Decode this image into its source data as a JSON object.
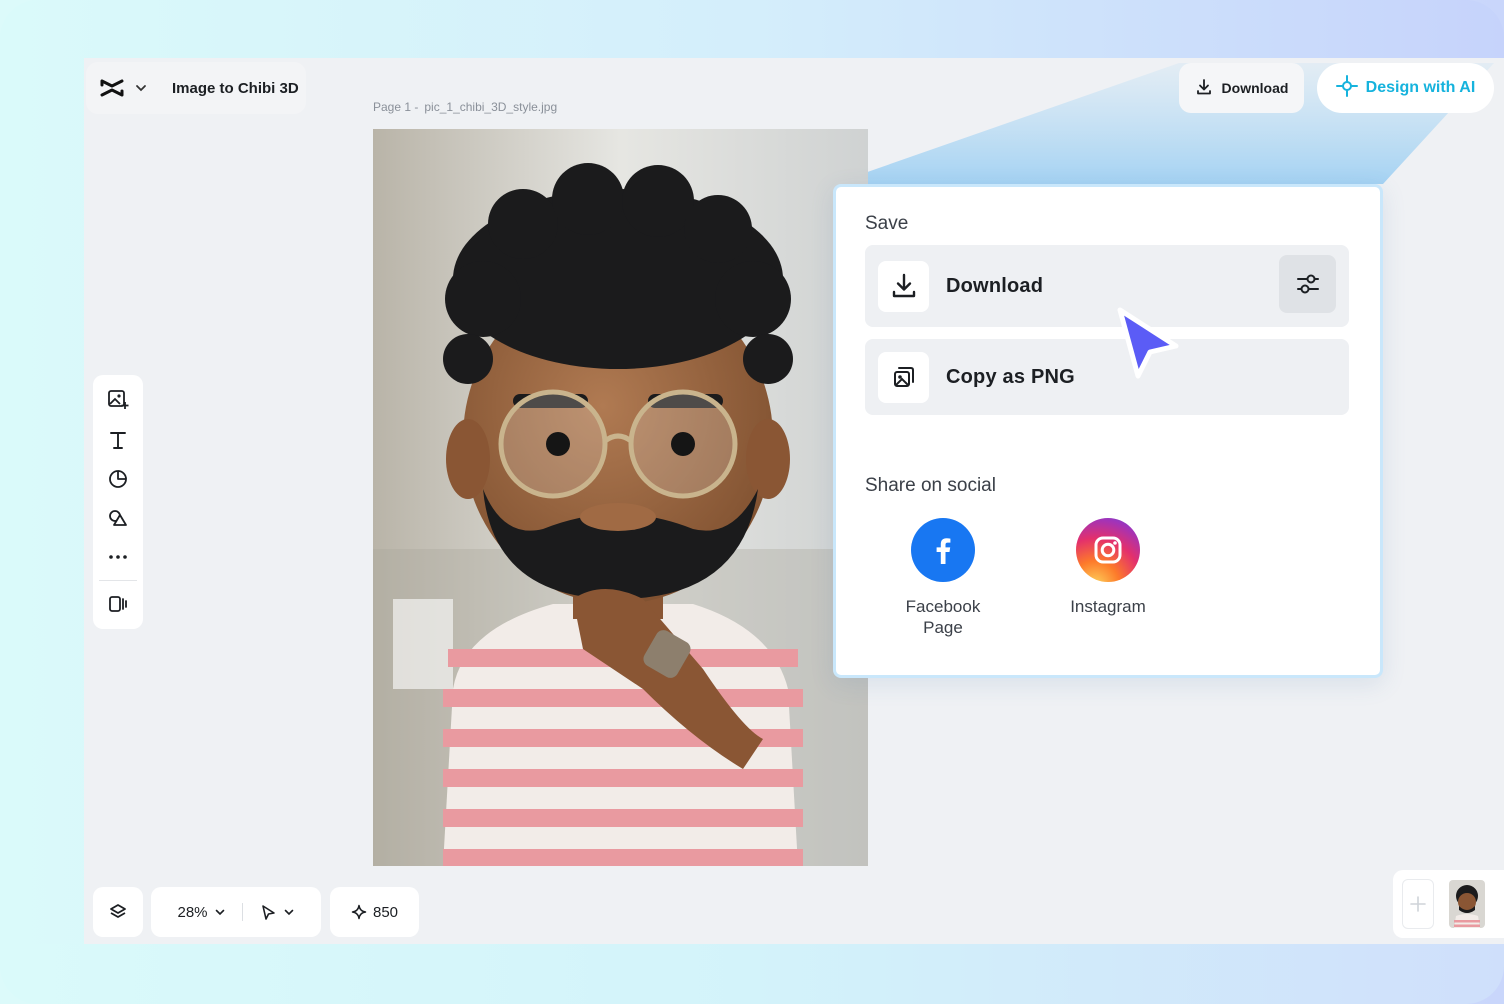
{
  "header": {
    "project_title": "Image to Chibi 3D",
    "page_label": "Page 1 -",
    "file_name": "pic_1_chibi_3D_style.jpg",
    "download_label": "Download",
    "design_ai_label": "Design with AI"
  },
  "save_panel": {
    "save_heading": "Save",
    "download_option": "Download",
    "copy_option": "Copy as PNG",
    "share_heading": "Share on social",
    "social": [
      {
        "label": "Facebook Page",
        "icon": "facebook-icon"
      },
      {
        "label": "Instagram",
        "icon": "instagram-icon"
      }
    ]
  },
  "left_toolbar": {
    "tools": [
      "add-image-icon",
      "text-icon",
      "sticker-icon",
      "shapes-icon",
      "more-icon",
      "layout-icon"
    ]
  },
  "bottom_bar": {
    "zoom": "28%",
    "credits": "850"
  },
  "colors": {
    "accent": "#16b3dd",
    "cursor": "#5b5cf6",
    "panel_border": "#c9e7fb"
  }
}
